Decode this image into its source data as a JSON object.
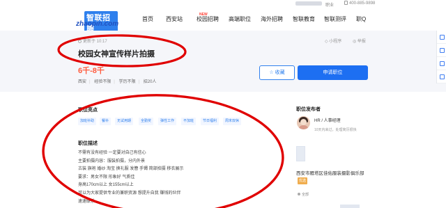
{
  "topbar": {
    "history": "职业",
    "phone": "400-885-9898"
  },
  "logo": {
    "brand_cn": "智联招聘",
    "brand_en": "zhaopin.com"
  },
  "nav": {
    "items": [
      "首页",
      "西安站",
      "校园招聘",
      "高端职位",
      "海外招聘",
      "智联教育",
      "智联测评",
      "职Q"
    ],
    "new_badge": "NEW"
  },
  "job": {
    "updated": "更新于 10:17",
    "title": "校园女神宣传样片拍摄",
    "salary": "6千-8千",
    "requirements": [
      "西安",
      "经验不限",
      "学历不限",
      "招20人"
    ],
    "mini_program": "小程序",
    "report": "举报",
    "favorite_label": "收藏",
    "apply_label": "申请职位"
  },
  "highlights": {
    "heading": "职位亮点",
    "tags": [
      "加班补助",
      "餐补",
      "无试用期",
      "全勤奖",
      "弹性工作",
      "不加班",
      "节日福利",
      "周末双休"
    ]
  },
  "description": {
    "heading": "职位描述",
    "lines": [
      "不需有没有经验  一定要对自己有信心",
      "主要拍摄内容：服装拍摄，分内外景",
      "古装  旗袍  婚纱  淘宝  换礼服  发簪  手镯  简部拍摄  移衣展示",
      "要求：男女不限  形象好  气质佳",
      "身高170cm以上  女155cm以上",
      "可以为大家提供专业的兼职资源  想提升自我  赚钱的伙伴",
      "速速联系"
    ]
  },
  "publisher": {
    "heading": "职位发布者",
    "name": "HR / 人事经理",
    "meta": "10天内来过，处理简历很快",
    "company": "西安市雁塔区佳佑服装摄影俱乐部",
    "company_badge": "优选",
    "company_size": "全部"
  },
  "colors": {
    "accent": "#1d6ff2",
    "salary": "#ff5a3c",
    "annotation": "#e00000"
  }
}
